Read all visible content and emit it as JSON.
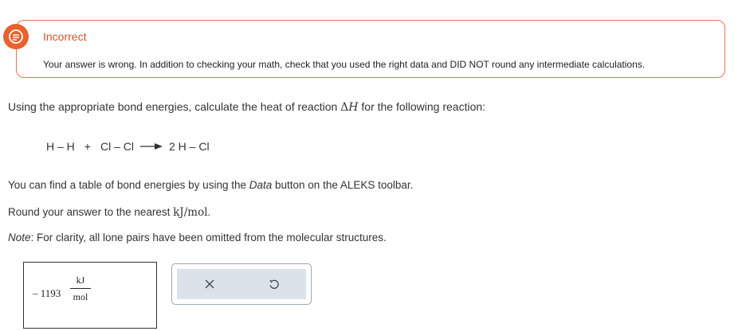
{
  "feedback": {
    "title": "Incorrect",
    "message": "Your answer is wrong. In addition to checking your math, check that you used the right data and DID NOT round any intermediate calculations.",
    "accent_color": "#e8612e"
  },
  "question": {
    "prompt_before": "Using the appropriate bond energies, calculate the heat of reaction ",
    "delta_symbol": "Δ",
    "h_symbol": "H",
    "prompt_after": " for the following reaction:"
  },
  "reaction": {
    "reactant1": "H – H",
    "plus": "+",
    "reactant2": "Cl – Cl",
    "product": "2 H – Cl"
  },
  "instructions": {
    "data_before": "You can find a table of bond energies by using the ",
    "data_word": "Data",
    "data_after": " button on the ALEKS toolbar.",
    "round_before": "Round your answer to the nearest ",
    "round_unit": "kJ/mol",
    "round_after": ".",
    "note_label": "Note",
    "note_text": ": For clarity, all lone pairs have been omitted from the molecular structures."
  },
  "answer": {
    "value": "– 1193",
    "unit_numerator": "kJ",
    "unit_denominator": "mol"
  },
  "tools": {
    "clear_icon": "x-icon",
    "undo_icon": "undo-icon"
  }
}
